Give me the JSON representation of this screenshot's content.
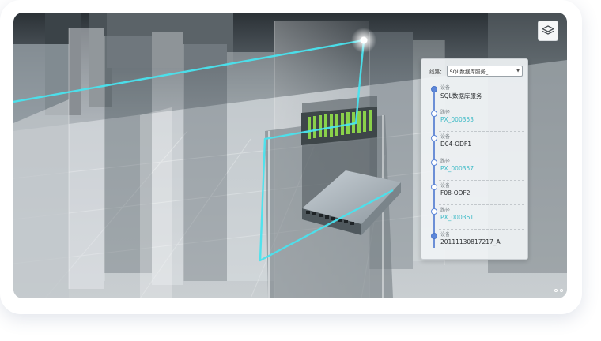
{
  "panel": {
    "route_label": "线路：",
    "route_value": "SQL数据库服务_..."
  },
  "route": [
    {
      "type": "设备",
      "value": "SQL数据库服务",
      "kind": "device"
    },
    {
      "type": "路径",
      "value": "PX_000353",
      "kind": "path"
    },
    {
      "type": "设备",
      "value": "D04-ODF1",
      "kind": "device"
    },
    {
      "type": "路径",
      "value": "PX_000357",
      "kind": "path"
    },
    {
      "type": "设备",
      "value": "F08-ODF2",
      "kind": "device"
    },
    {
      "type": "路径",
      "value": "PX_000361",
      "kind": "path"
    },
    {
      "type": "设备",
      "value": "20111130817217_A",
      "kind": "device"
    }
  ],
  "icons": {
    "layer_toggle": "layers-icon",
    "pager": "pager-dots-icon"
  },
  "colors": {
    "route_line": "#49e3ee",
    "timeline": "#5d87d9",
    "path_link": "#3bbac6",
    "port_led": "#8ad14a"
  }
}
